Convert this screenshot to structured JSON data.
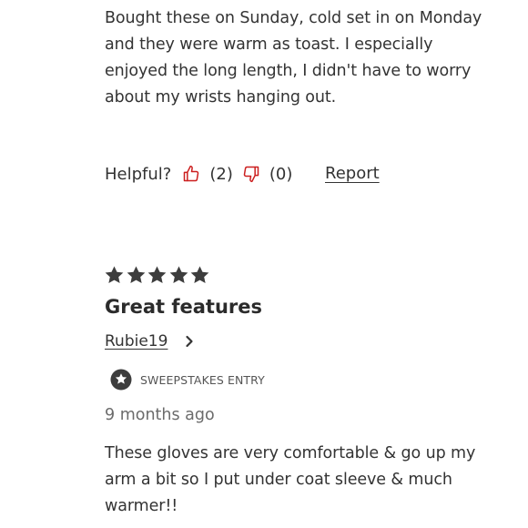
{
  "review1": {
    "text": "Bought these on Sunday, cold set in on Monday and they were warm as toast. I especially enjoyed the long length, I didn't have to worry about my wrists hanging out.",
    "helpful_label": "Helpful?",
    "helpful_up_count": "(2)",
    "helpful_down_count": "(0)",
    "report_label": "Report"
  },
  "review2": {
    "rating": 5,
    "title": "Great features",
    "author": "Rubie19",
    "badge": "SWEEPSTAKES ENTRY",
    "time_ago": "9 months ago",
    "text": "These gloves are very comfortable & go up my arm a bit so I put under coat sleeve & much warmer!!"
  },
  "colors": {
    "thumb_accent": "#cc1f1f",
    "star_fill": "#3d3d3d",
    "text": "#333333"
  },
  "icons": {
    "thumbs_up": "thumbs-up-icon",
    "thumbs_down": "thumbs-down-icon",
    "star": "star-icon",
    "chevron": "chevron-right-icon",
    "badge": "star-badge-icon"
  }
}
